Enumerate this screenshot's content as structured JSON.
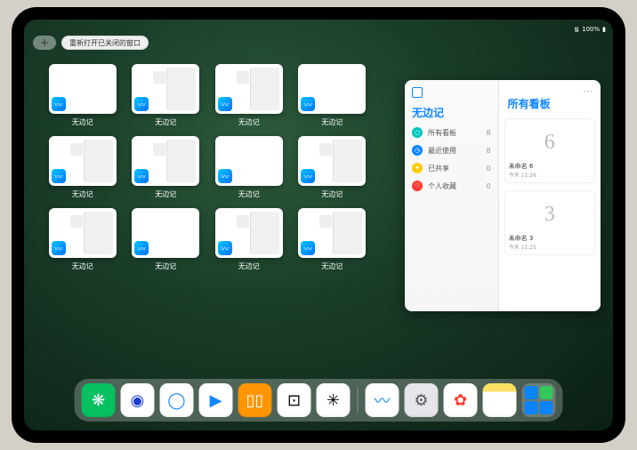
{
  "status": {
    "time": "",
    "wifi": "᯾",
    "battery": "100%"
  },
  "add_button": "+",
  "reopen_pill": "重新打开已关闭的窗口",
  "app_label": "无边记",
  "grid": [
    {
      "variant": "plain"
    },
    {
      "variant": "split"
    },
    {
      "variant": "split"
    },
    {
      "variant": "plain"
    },
    {
      "variant": "split"
    },
    {
      "variant": "split"
    },
    {
      "variant": "plain"
    },
    {
      "variant": "split"
    },
    {
      "variant": "split"
    },
    {
      "variant": "plain"
    },
    {
      "variant": "split"
    },
    {
      "variant": "split"
    }
  ],
  "large_window": {
    "more": "...",
    "left_title": "无边记",
    "rows": [
      {
        "icon_color": "#00c6c0",
        "glyph": "○",
        "label": "所有看板",
        "count": "8"
      },
      {
        "icon_color": "#0a84ff",
        "glyph": "◷",
        "label": "最近使用",
        "count": "8"
      },
      {
        "icon_color": "#ffcc00",
        "glyph": "✦",
        "label": "已共享",
        "count": "0"
      },
      {
        "icon_color": "#ff3b30",
        "glyph": "♡",
        "label": "个人收藏",
        "count": "0"
      }
    ],
    "right_title": "所有看板",
    "boards": [
      {
        "glyph": "6",
        "name": "未命名 6",
        "date": "今天 11:26"
      },
      {
        "glyph": "3",
        "name": "未命名 3",
        "date": "今天 11:25"
      }
    ]
  },
  "dock": [
    {
      "name": "wechat",
      "bg": "#07c160",
      "glyph": "❋",
      "fg": "#fff"
    },
    {
      "name": "quark",
      "bg": "#ffffff",
      "glyph": "◉",
      "fg": "#1b3bd1"
    },
    {
      "name": "browser",
      "bg": "#ffffff",
      "glyph": "◯",
      "fg": "#0a84ff"
    },
    {
      "name": "play",
      "bg": "#ffffff",
      "glyph": "▶",
      "fg": "#0a84ff"
    },
    {
      "name": "books",
      "bg": "#ff9500",
      "glyph": "▯▯",
      "fg": "#fff"
    },
    {
      "name": "dice",
      "bg": "#ffffff",
      "glyph": "⊡",
      "fg": "#000"
    },
    {
      "name": "connect",
      "bg": "#ffffff",
      "glyph": "✳",
      "fg": "#000"
    },
    {
      "sep": true
    },
    {
      "name": "freeform",
      "bg": "#ffffff",
      "glyph": "〰",
      "fg": "#0a84ff"
    },
    {
      "name": "settings",
      "bg": "#e5e5ea",
      "glyph": "⚙",
      "fg": "#555"
    },
    {
      "name": "photos",
      "bg": "#ffffff",
      "glyph": "✿",
      "fg": "#ff3b30"
    },
    {
      "name": "notes",
      "bg": "linear-gradient(#ffe066 25%, #ffffff 25%)",
      "glyph": "",
      "fg": "#000"
    },
    {
      "cluster": true,
      "name": "app-library",
      "cells": [
        "#0a84ff",
        "#34c759",
        "#0a84ff",
        "#0a84ff"
      ]
    }
  ]
}
